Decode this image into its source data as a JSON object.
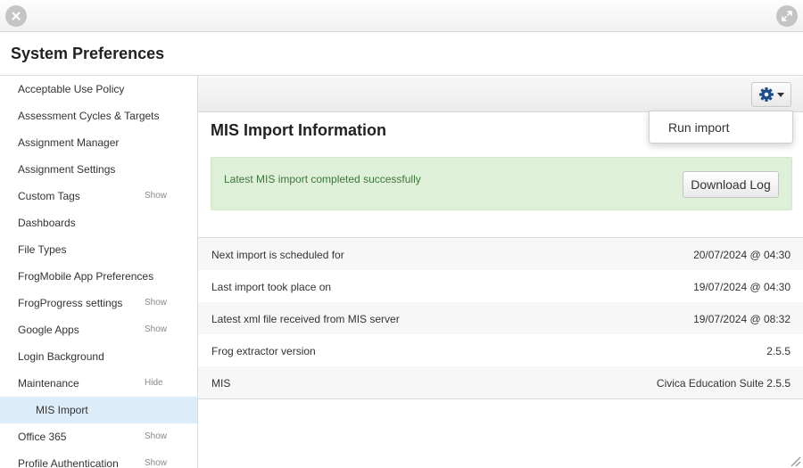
{
  "window": {
    "title": "System Preferences"
  },
  "icons": {
    "close": "close-icon",
    "expand": "expand-icon",
    "settings": "gear-icon",
    "resize": "resize-handle-icon"
  },
  "colors": {
    "accent_gear": "#1f4e8c",
    "active_nav_bg": "#dcecf9",
    "alert_bg": "#dff0d8",
    "alert_text": "#3c763d"
  },
  "sidebar": {
    "items": [
      {
        "label": "Acceptable Use Policy",
        "toggle": ""
      },
      {
        "label": "Assessment Cycles & Targets",
        "toggle": ""
      },
      {
        "label": "Assignment Manager",
        "toggle": ""
      },
      {
        "label": "Assignment Settings",
        "toggle": ""
      },
      {
        "label": "Custom Tags",
        "toggle": "Show"
      },
      {
        "label": "Dashboards",
        "toggle": ""
      },
      {
        "label": "File Types",
        "toggle": ""
      },
      {
        "label": "FrogMobile App Preferences",
        "toggle": ""
      },
      {
        "label": "FrogProgress settings",
        "toggle": "Show"
      },
      {
        "label": "Google Apps",
        "toggle": "Show"
      },
      {
        "label": "Login Background",
        "toggle": ""
      },
      {
        "label": "Maintenance",
        "toggle": "Hide"
      },
      {
        "label": "MIS Import",
        "toggle": ""
      },
      {
        "label": "Office 365",
        "toggle": "Show"
      },
      {
        "label": "Profile Authentication",
        "toggle": "Show"
      }
    ]
  },
  "toolbar": {
    "dropdown": {
      "items": [
        {
          "label": "Run import"
        }
      ]
    }
  },
  "main": {
    "title": "MIS Import Information",
    "alert": {
      "message": "Latest MIS import completed successfully",
      "button_label": "Download Log"
    },
    "info_rows": [
      {
        "key": "Next import is scheduled for",
        "value": "20/07/2024 @ 04:30"
      },
      {
        "key": "Last import took place on",
        "value": "19/07/2024 @ 04:30"
      },
      {
        "key": "Latest xml file received from MIS server",
        "value": "19/07/2024 @ 08:32"
      },
      {
        "key": "Frog extractor version",
        "value": "2.5.5"
      },
      {
        "key": "MIS",
        "value": "Civica Education Suite 2.5.5"
      }
    ]
  }
}
